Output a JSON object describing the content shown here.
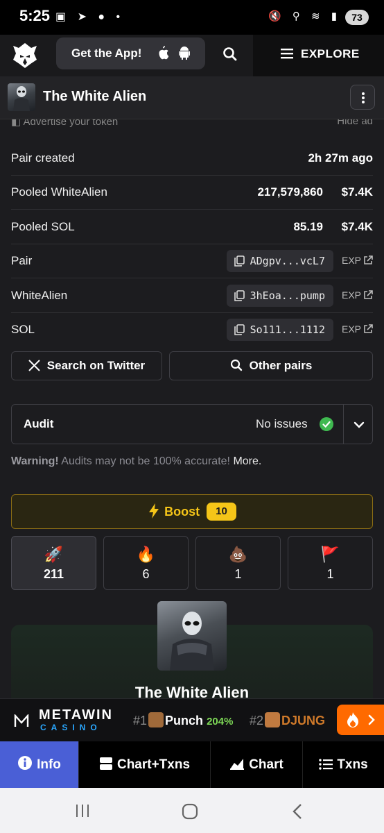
{
  "status_bar": {
    "time": "5:25",
    "battery": "73"
  },
  "top_nav": {
    "get_app_label": "Get the App!",
    "explore_label": "EXPLORE"
  },
  "token": {
    "name": "The White Alien"
  },
  "ad": {
    "advertise_label": "Advertise your token",
    "hide_label": "Hide ad"
  },
  "info_rows": [
    {
      "label": "Pair created",
      "value": "2h 27m ago"
    },
    {
      "label": "Pooled WhiteAlien",
      "amount": "217,579,860",
      "usd": "$7.4K"
    },
    {
      "label": "Pooled SOL",
      "amount": "85.19",
      "usd": "$7.4K"
    },
    {
      "label": "Pair",
      "address": "ADgpv...vcL7",
      "exp": "EXP"
    },
    {
      "label": "WhiteAlien",
      "address": "3hEoa...pump",
      "exp": "EXP"
    },
    {
      "label": "SOL",
      "address": "So111...1112",
      "exp": "EXP"
    }
  ],
  "actions": {
    "twitter_label": "Search on Twitter",
    "other_pairs_label": "Other pairs"
  },
  "audit": {
    "title": "Audit",
    "status": "No issues",
    "warning_bold": "Warning!",
    "warning_text": " Audits may not be 100% accurate! ",
    "more_label": "More."
  },
  "boost": {
    "label": "Boost",
    "count": "10"
  },
  "reactions": [
    {
      "icon": "rocket-icon",
      "glyph": "🚀",
      "count": "211"
    },
    {
      "icon": "fire-icon",
      "glyph": "🔥",
      "count": "6"
    },
    {
      "icon": "poop-icon",
      "glyph": "💩",
      "count": "1"
    },
    {
      "icon": "flag-icon",
      "glyph": "🚩",
      "count": "1"
    }
  ],
  "card": {
    "title": "The White Alien"
  },
  "ticker": {
    "brand_top": "METAWIN",
    "brand_bottom": "CASINO",
    "items": [
      {
        "rank": "#1",
        "name": "Punch",
        "change": "204%"
      },
      {
        "rank": "#2",
        "name": "DJUNG"
      }
    ]
  },
  "bottom_tabs": [
    {
      "label": "Info"
    },
    {
      "label": "Chart+Txns"
    },
    {
      "label": "Chart"
    },
    {
      "label": "Txns"
    }
  ],
  "colors": {
    "accent_blue": "#4a5fd6",
    "boost_yellow": "#f5c518",
    "ok_green": "#3fb950",
    "gain_green": "#7ed957",
    "fire_orange": "#ff6a00"
  }
}
